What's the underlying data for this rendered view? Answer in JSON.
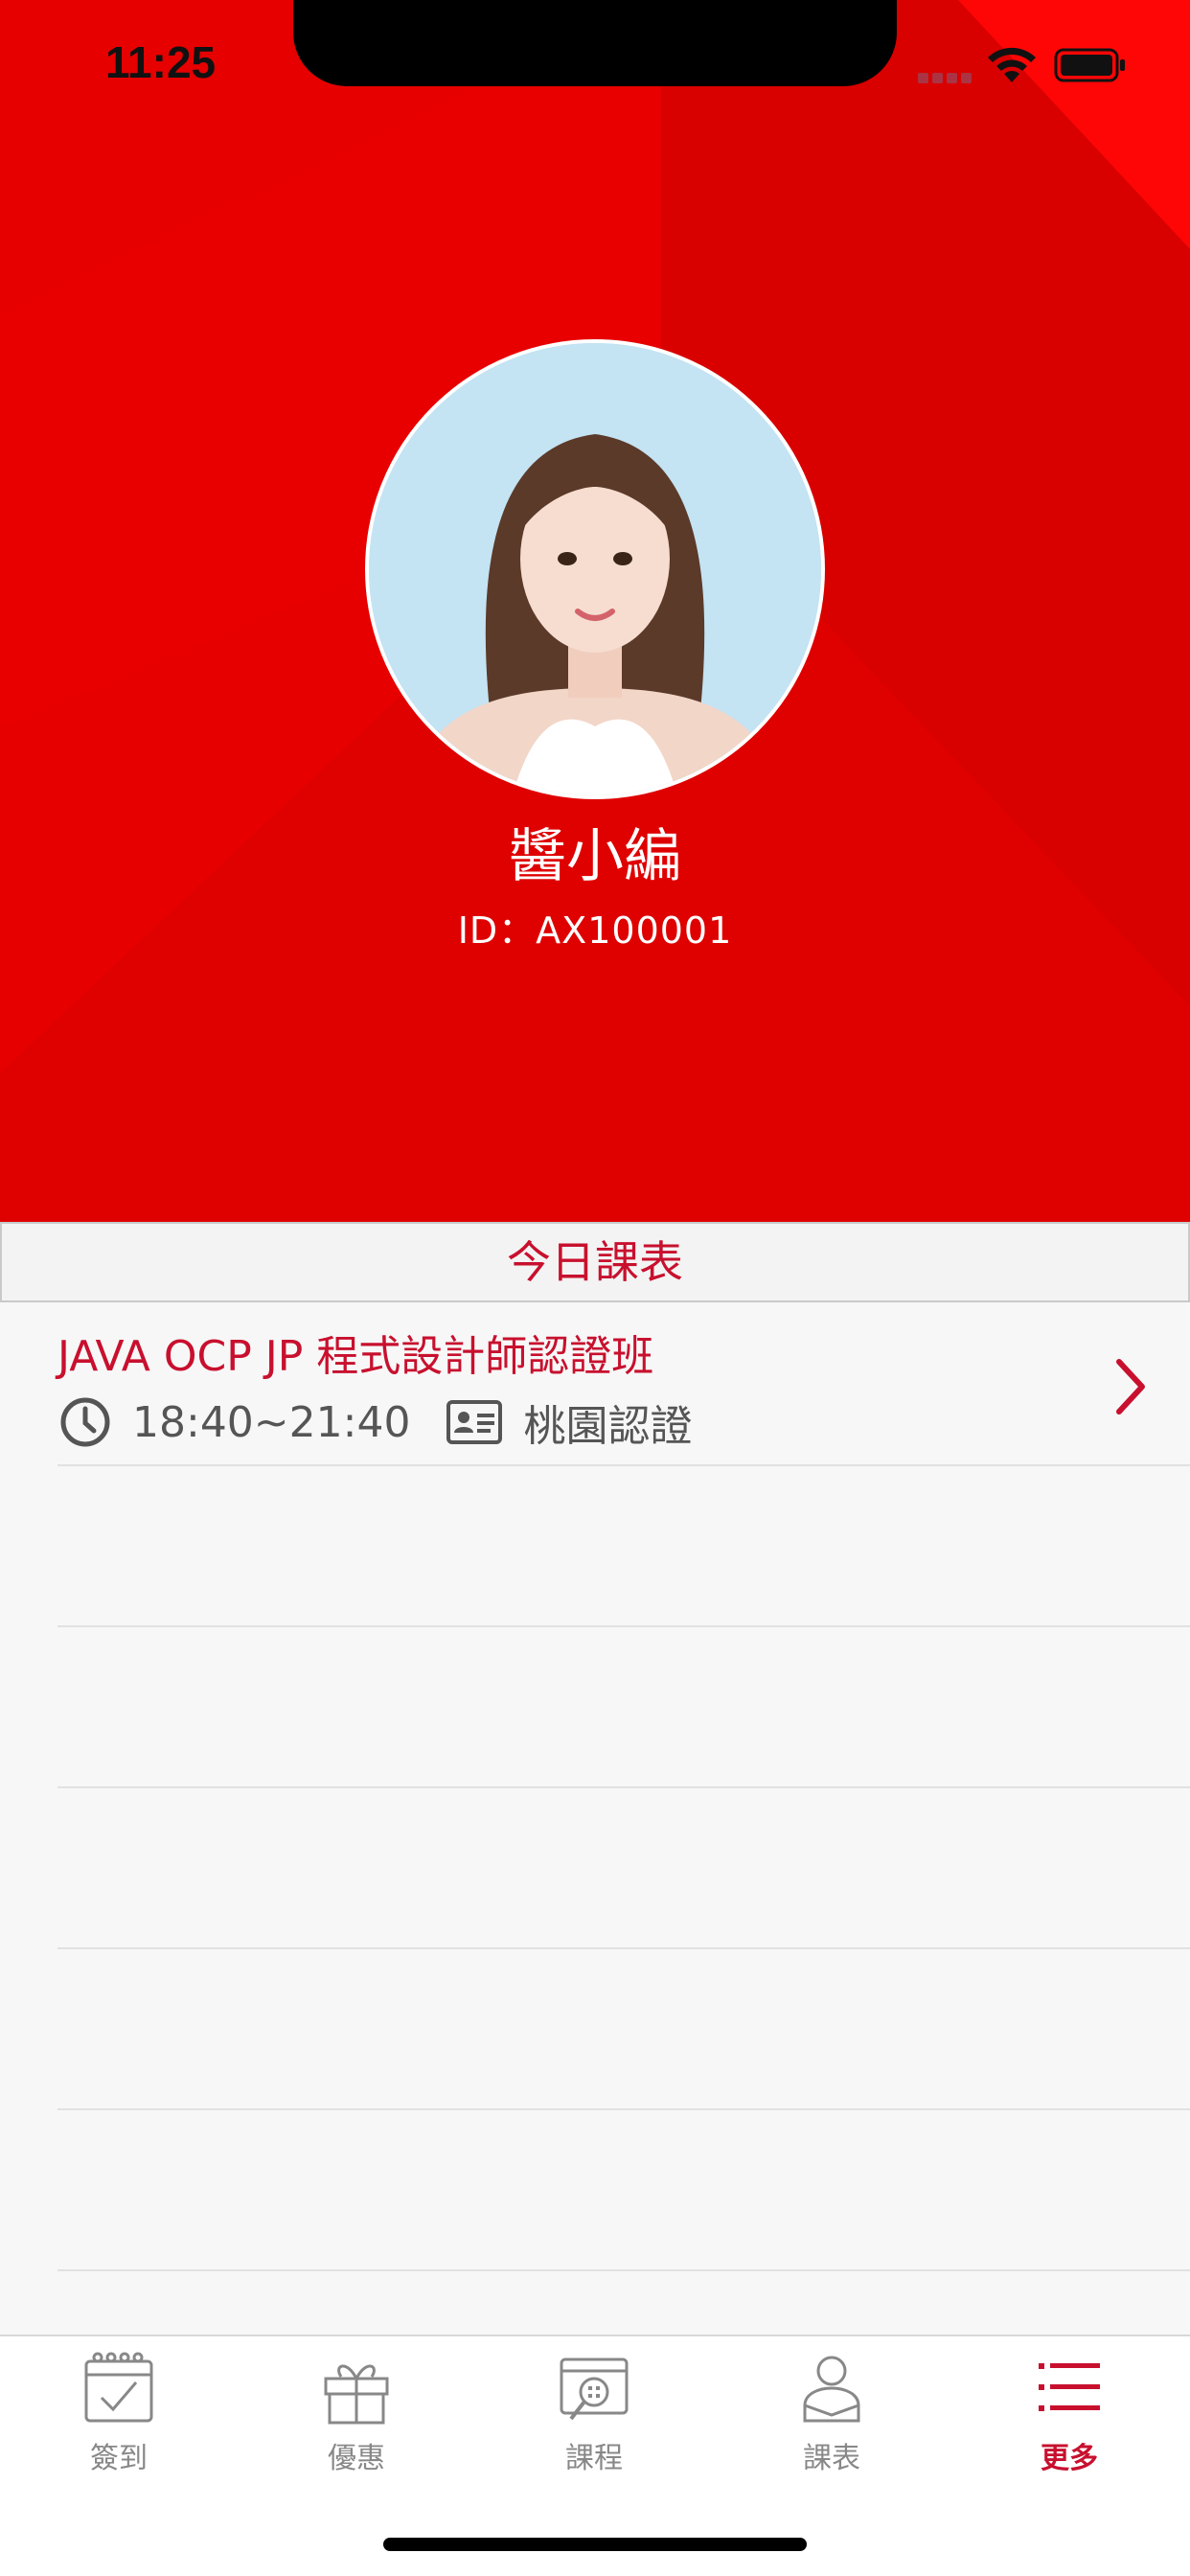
{
  "status_bar": {
    "time": "11:25"
  },
  "profile": {
    "name": "醬小編",
    "id_text": "ID：AX100001"
  },
  "schedule": {
    "header": "今日課表",
    "courses": [
      {
        "title": "JAVA OCP JP 程式設計師認證班",
        "time": "18:40~21:40",
        "location": "桃園認證"
      }
    ]
  },
  "tabbar": {
    "items": [
      {
        "label": "簽到",
        "icon": "calendar-check-icon"
      },
      {
        "label": "優惠",
        "icon": "gift-icon"
      },
      {
        "label": "課程",
        "icon": "calendar-search-icon"
      },
      {
        "label": "課表",
        "icon": "person-icon"
      },
      {
        "label": "更多",
        "icon": "menu-list-icon"
      }
    ],
    "active": 4
  },
  "colors": {
    "brand_red": "#e60000",
    "accent_text": "#c8102e"
  }
}
